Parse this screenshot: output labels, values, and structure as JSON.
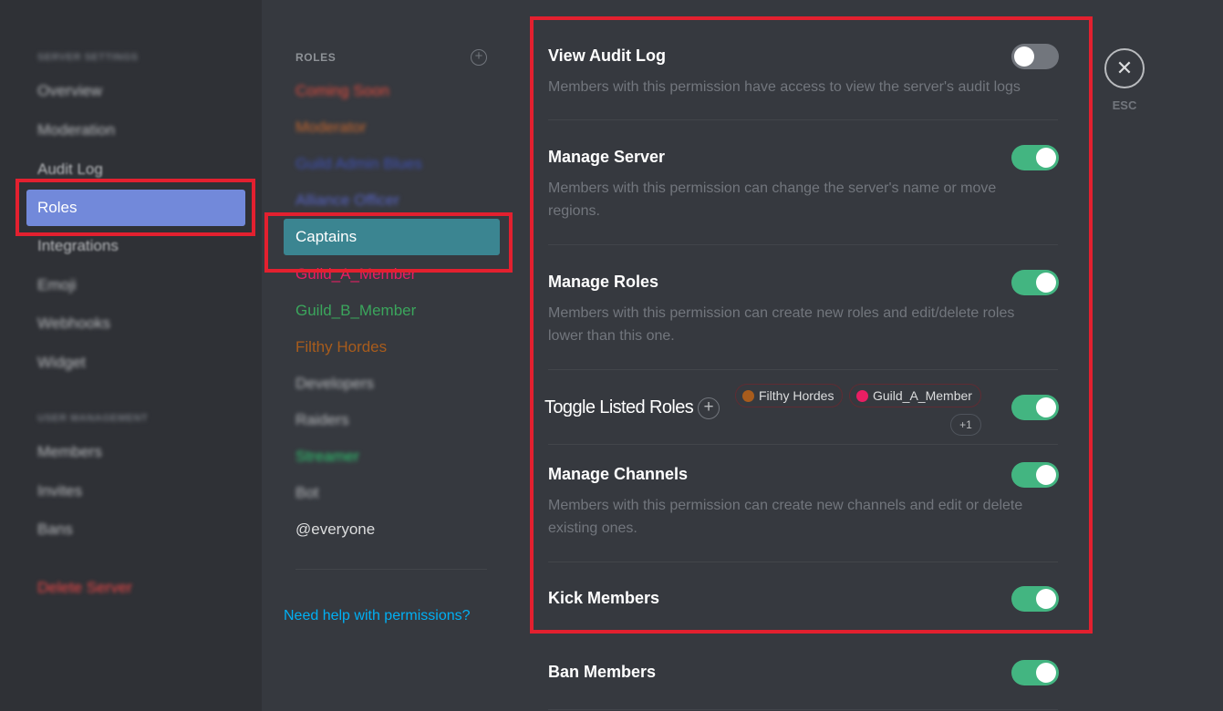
{
  "sidebar": {
    "server_heading": "SERVER SETTINGS",
    "items": [
      "Overview",
      "Moderation",
      "Audit Log",
      "Roles",
      "Integrations",
      "Emoji",
      "Webhooks",
      "Widget"
    ],
    "user_heading": "USER MANAGEMENT",
    "user_items": [
      "Members",
      "Invites",
      "Bans"
    ],
    "delete_label": "Delete Server"
  },
  "roles": {
    "heading": "ROLES",
    "list": [
      {
        "label": "Coming Soon",
        "color": "#e74c3c",
        "blurred": true
      },
      {
        "label": "Moderator",
        "color": "#c8682d",
        "blurred": true
      },
      {
        "label": "Guild Admin Blues",
        "color": "#3f51b5",
        "blurred": true
      },
      {
        "label": "Alliance Officer",
        "color": "#5865c6",
        "blurred": true
      },
      {
        "label": "Captains",
        "color": "#ffffff",
        "blurred": false,
        "active": true
      },
      {
        "label": "Guild_A_Member",
        "color": "#e91e63",
        "blurred": false
      },
      {
        "label": "Guild_B_Member",
        "color": "#3ba55c",
        "blurred": false
      },
      {
        "label": "Filthy Hordes",
        "color": "#a85c1c",
        "blurred": false
      },
      {
        "label": "Developers",
        "color": "#b9bbbe",
        "blurred": true
      },
      {
        "label": "Raiders",
        "color": "#b9bbbe",
        "blurred": true
      },
      {
        "label": "Streamer",
        "color": "#2ecc71",
        "blurred": true
      },
      {
        "label": "Bot",
        "color": "#b9bbbe",
        "blurred": true
      },
      {
        "label": "@everyone",
        "color": "#dcddde",
        "blurred": false
      }
    ],
    "help_link": "Need help with permissions?"
  },
  "permissions": [
    {
      "title": "View Audit Log",
      "desc": "Members with this permission have access to view the server's audit logs",
      "enabled": false
    },
    {
      "title": "Manage Server",
      "desc": "Members with this permission can change the server's name or move regions.",
      "enabled": true
    },
    {
      "title": "Manage Roles",
      "desc": "Members with this permission can create new roles and edit/delete roles lower than this one.",
      "enabled": true
    },
    {
      "title": "Manage Channels",
      "desc": "Members with this permission can create new channels and edit or delete existing ones.",
      "enabled": true
    },
    {
      "title": "Kick Members",
      "desc": "",
      "enabled": true
    },
    {
      "title": "Ban Members",
      "desc": "",
      "enabled": true
    }
  ],
  "toggle_listed": {
    "label": "Toggle Listed Roles",
    "add_icon": "plus-icon",
    "chips": [
      {
        "label": "Filthy Hordes",
        "color": "#a85c1c"
      },
      {
        "label": "Guild_A_Member",
        "color": "#e91e63"
      }
    ],
    "more": "+1",
    "enabled": true
  },
  "close": {
    "icon": "close-icon",
    "esc_label": "ESC"
  },
  "colors": {
    "accent": "#7289da",
    "toggle_on": "#43b581",
    "highlight": "#e3202f",
    "link": "#00b0f4"
  }
}
